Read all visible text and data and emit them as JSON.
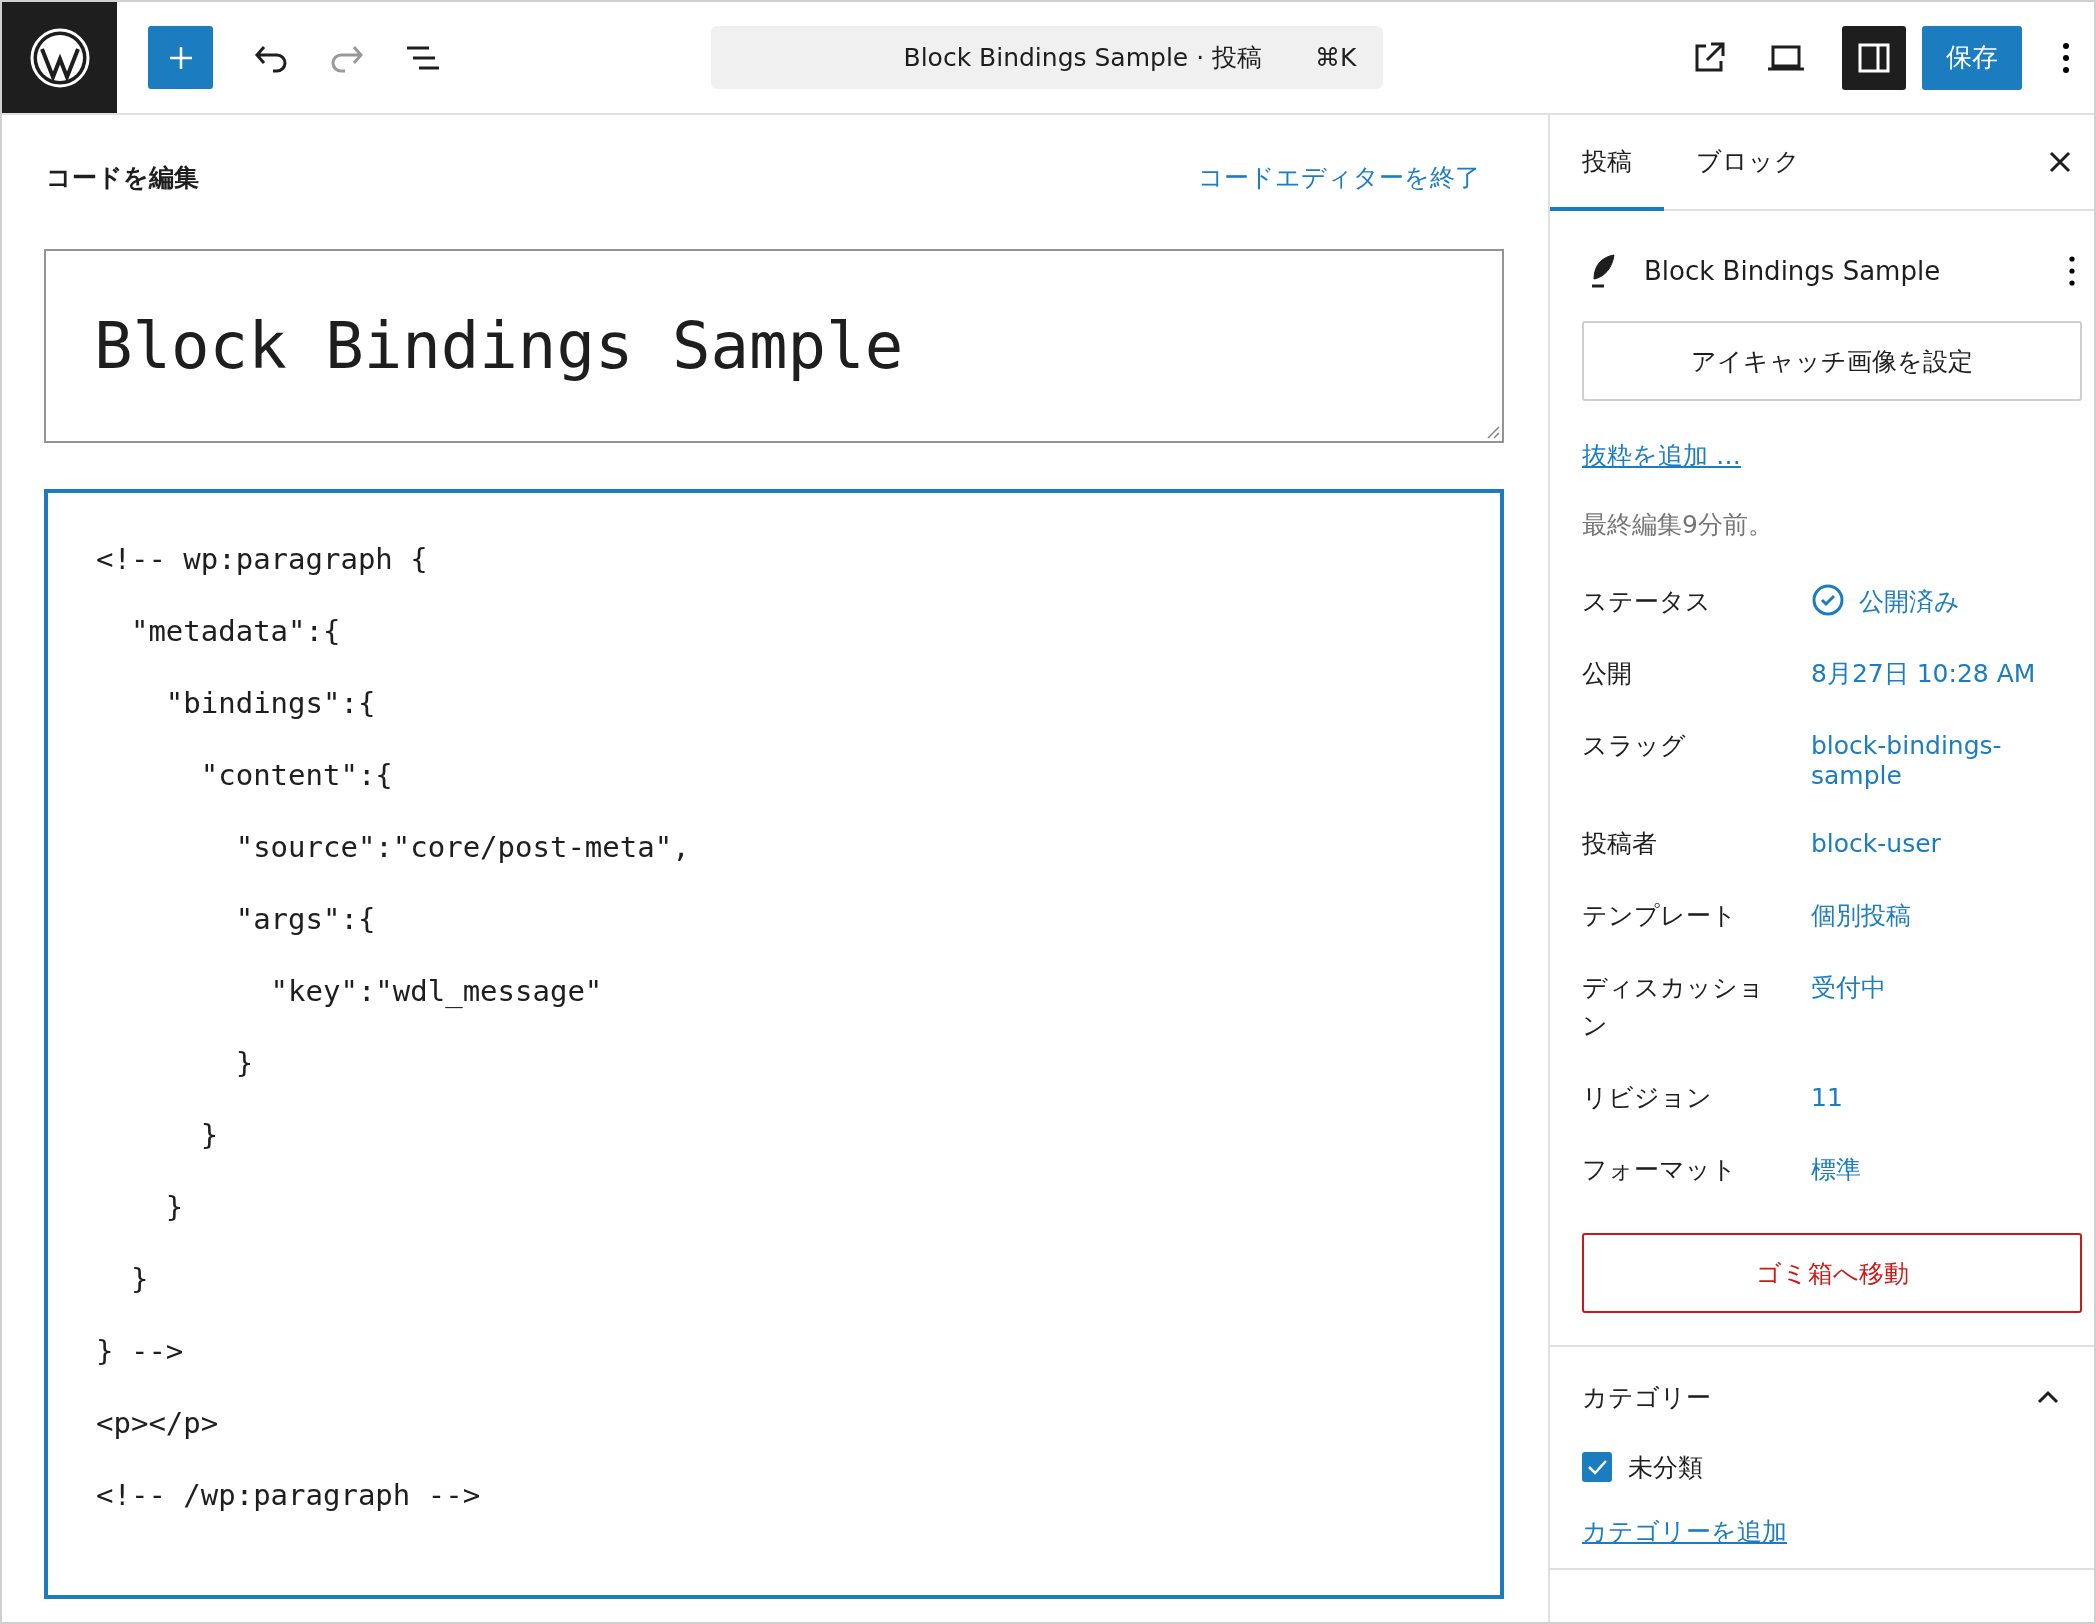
{
  "toolbar": {
    "command_bar": {
      "title": "Block Bindings Sample · 投稿",
      "shortcut": "⌘K"
    },
    "sidebar_toggle_on": true,
    "save_label": "保存"
  },
  "editor": {
    "heading": "コードを編集",
    "exit_link": "コードエディターを終了",
    "title_value": "Block Bindings Sample",
    "code_lines": [
      "<!-- wp:paragraph {",
      "  \"metadata\":{",
      "    \"bindings\":{",
      "      \"content\":{",
      "        \"source\":\"core/post-meta\",",
      "        \"args\":{",
      "          \"key\":\"wdl_message\"",
      "        }",
      "      }",
      "    }",
      "  }",
      "} -->",
      "<p></p>",
      "<!-- /wp:paragraph -->"
    ]
  },
  "sidebar": {
    "tabs": [
      {
        "label": "投稿",
        "selected": true
      },
      {
        "label": "ブロック",
        "selected": false
      }
    ],
    "post_title": "Block Bindings Sample",
    "featured_image_button": "アイキャッチ画像を設定",
    "excerpt_link": "抜粋を追加 …",
    "last_edited": "最終編集9分前。",
    "rows": [
      {
        "label": "ステータス",
        "value": "公開済み",
        "kind": "status"
      },
      {
        "label": "公開",
        "value": "8月27日 10:28 AM",
        "kind": "link"
      },
      {
        "label": "スラッグ",
        "value": "block-bindings-sample",
        "kind": "link"
      },
      {
        "label": "投稿者",
        "value": "block-user",
        "kind": "link"
      },
      {
        "label": "テンプレート",
        "value": "個別投稿",
        "kind": "link"
      },
      {
        "label": "ディスカッション",
        "value": "受付中",
        "kind": "link"
      },
      {
        "label": "リビジョン",
        "value": "11",
        "kind": "link"
      },
      {
        "label": "フォーマット",
        "value": "標準",
        "kind": "link"
      }
    ],
    "trash_button": "ゴミ箱へ移動",
    "categories": {
      "title": "カテゴリー",
      "expanded": true,
      "items": [
        {
          "label": "未分類",
          "checked": true
        }
      ],
      "add_link": "カテゴリーを追加"
    }
  }
}
